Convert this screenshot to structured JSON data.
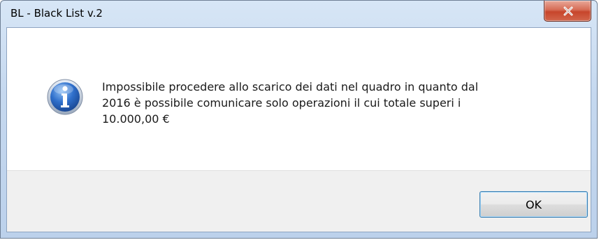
{
  "window": {
    "title": "BL - Black List v.2"
  },
  "titlebar": {
    "close_button_glyph": "x",
    "close_color": "#c7452b"
  },
  "dialog": {
    "icon": "info-icon",
    "message": "Impossibile procedere allo scarico dei dati nel quadro in quanto dal\n2016 è possibile comunicare solo operazioni il cui totale superi i\n10.000,00 €"
  },
  "buttons": {
    "ok_label": "OK"
  },
  "colors": {
    "frame": "#bcd1eb",
    "footer": "#f0f0f0",
    "icon_blue": "#2f6fcb"
  }
}
